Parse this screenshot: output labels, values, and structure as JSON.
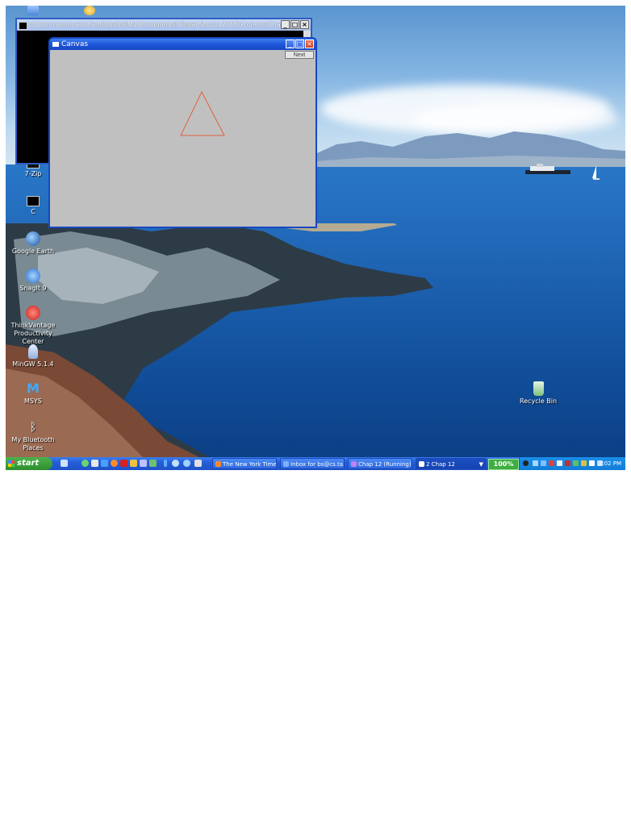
{
  "console_window": {
    "title": "c:\\Documents and Settings\\bs\\My Documents\\Visual Studio 2005\\Projects\\Chap ..."
  },
  "canvas_window": {
    "title": "Canvas",
    "next_label": "Next",
    "shape_color": "#e0603c"
  },
  "desktop_icons": [
    {
      "label": "7-Zip"
    },
    {
      "label": "C"
    },
    {
      "label": "Google Earth"
    },
    {
      "label": "SnagIt 9"
    },
    {
      "label": "ThinkVantage Productivity Center"
    },
    {
      "label": "MinGW 5.1.4"
    },
    {
      "label": "MSYS"
    },
    {
      "label": "My Bluetooth Places"
    },
    {
      "label": "Recycle Bin"
    }
  ],
  "taskbar": {
    "start_label": "start",
    "tasks": [
      {
        "label": "The New York Times..."
      },
      {
        "label": "Inbox for bs@cs.ta..."
      },
      {
        "label": "Chap 12 (Running) ..."
      },
      {
        "label": "2 Chap 12"
      }
    ],
    "battery": "100%",
    "clock": "2:02 PM"
  }
}
